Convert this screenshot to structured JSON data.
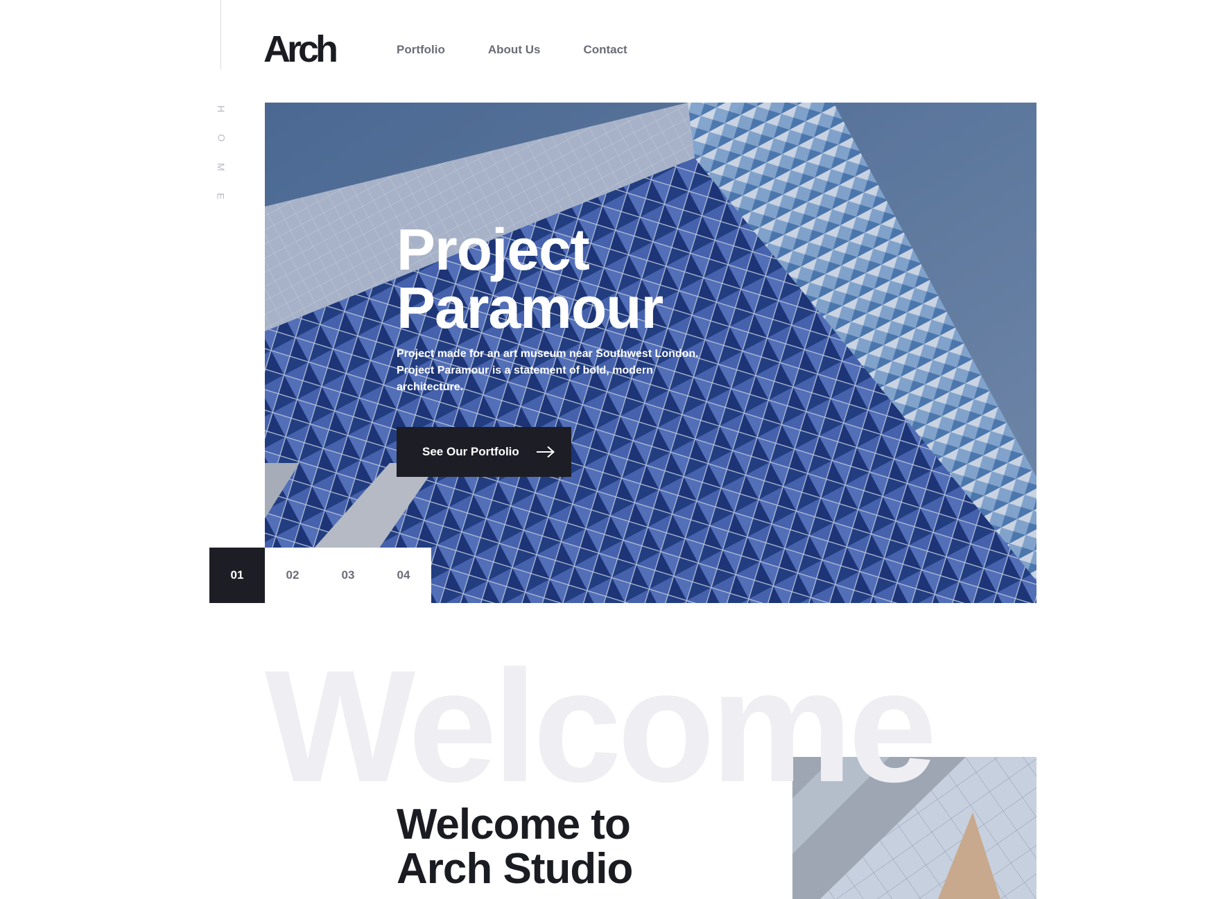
{
  "brand": {
    "logo_text": "Arch"
  },
  "nav": {
    "items": [
      {
        "label": "Portfolio"
      },
      {
        "label": "About Us"
      },
      {
        "label": "Contact"
      }
    ]
  },
  "side_label": {
    "letters": [
      "H",
      "O",
      "M",
      "E"
    ]
  },
  "hero": {
    "title_line1": "Project",
    "title_line2": "Paramour",
    "description": "Project made for an art museum near Southwest London. Project Paramour is a statement of bold, modern architecture.",
    "cta_label": "See Our Portfolio",
    "cta_icon": "arrow-right-icon"
  },
  "pager": {
    "items": [
      {
        "label": "01",
        "active": true
      },
      {
        "label": "02",
        "active": false
      },
      {
        "label": "03",
        "active": false
      },
      {
        "label": "04",
        "active": false
      }
    ]
  },
  "welcome": {
    "background_word": "Welcome",
    "title_line1": "Welcome to",
    "title_line2": "Arch Studio"
  },
  "colors": {
    "dark": "#1d1e25",
    "nav_text": "#6b6c78",
    "faint_text": "#eeeef3",
    "accent_blue": "#3d5aa8"
  }
}
